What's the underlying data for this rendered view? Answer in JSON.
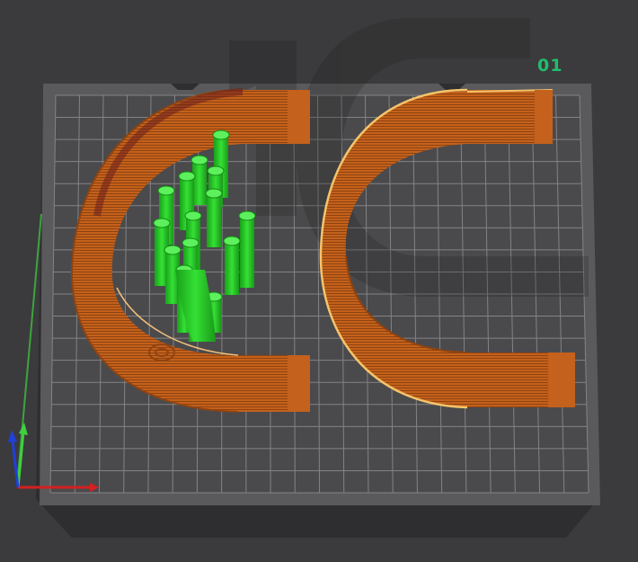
{
  "viewport": {
    "plate_label": "01",
    "plate_label_color": "#1fbf6b",
    "background_color": "#3b3b3d",
    "bed_color": "#4a4a4c",
    "grid_color": "#8a8a8d",
    "watermark_glyph": "1C"
  },
  "objects": [
    {
      "name": "curved-wall-left",
      "color": "#c8651f",
      "type": "sliced-part"
    },
    {
      "name": "curved-wall-right",
      "color": "#c8651f",
      "type": "sliced-part"
    },
    {
      "name": "tree-supports",
      "color": "#2ed12e",
      "type": "supports"
    }
  ],
  "axes": {
    "x_color": "#d42020",
    "y_color": "#3fd13f",
    "z_color": "#2040d8"
  }
}
